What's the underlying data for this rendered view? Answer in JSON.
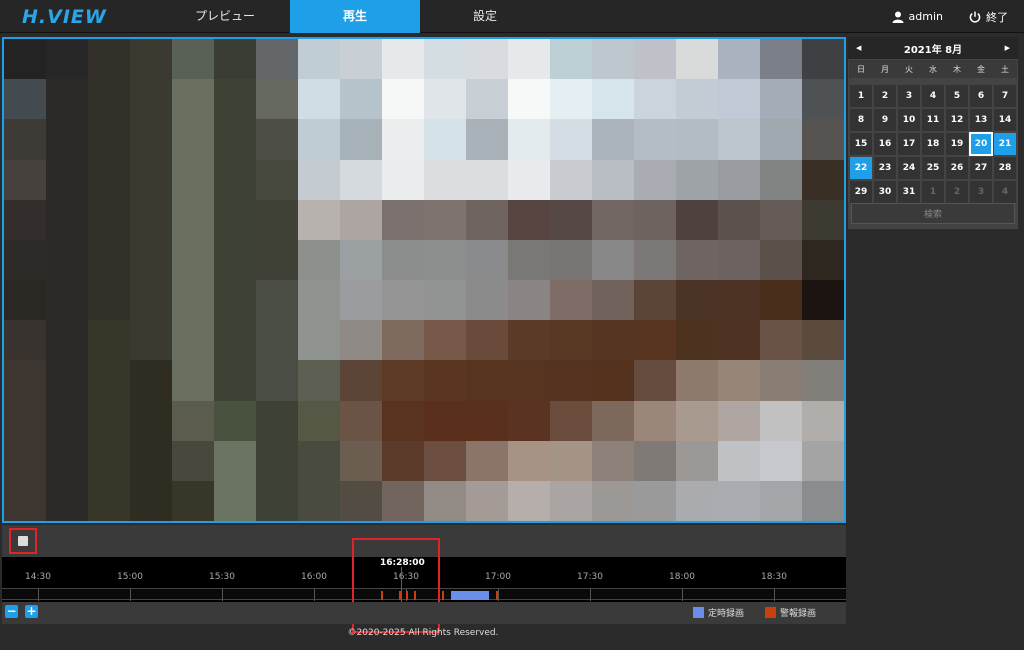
{
  "app": {
    "logo": "H.VIEW"
  },
  "nav": {
    "tabs": [
      {
        "label": "プレビュー"
      },
      {
        "label": "再生"
      },
      {
        "label": "設定"
      }
    ],
    "active": 1
  },
  "user": {
    "name": "admin",
    "exit_label": "終了"
  },
  "playback": {
    "current_time": "16:28:00",
    "time_labels": [
      "14:30",
      "15:00",
      "15:30",
      "16:00",
      "16:30",
      "17:00",
      "17:30",
      "18:00",
      "18:30"
    ],
    "legend": {
      "scheduled": "定時録画",
      "alarm": "警報録画"
    },
    "colors": {
      "scheduled": "#6b8ee8",
      "alarm": "#c84010",
      "accent": "#1e9fe8"
    }
  },
  "calendar": {
    "title": "2021年 8月",
    "weekdays": [
      "日",
      "月",
      "火",
      "水",
      "木",
      "金",
      "土"
    ],
    "days": [
      {
        "d": "1"
      },
      {
        "d": "2"
      },
      {
        "d": "3"
      },
      {
        "d": "4"
      },
      {
        "d": "5"
      },
      {
        "d": "6"
      },
      {
        "d": "7"
      },
      {
        "d": "8"
      },
      {
        "d": "9"
      },
      {
        "d": "10"
      },
      {
        "d": "11"
      },
      {
        "d": "12"
      },
      {
        "d": "13"
      },
      {
        "d": "14"
      },
      {
        "d": "15"
      },
      {
        "d": "16"
      },
      {
        "d": "17"
      },
      {
        "d": "18"
      },
      {
        "d": "19"
      },
      {
        "d": "20",
        "s": "sel"
      },
      {
        "d": "21",
        "s": "rec"
      },
      {
        "d": "22",
        "s": "rec"
      },
      {
        "d": "23"
      },
      {
        "d": "24"
      },
      {
        "d": "25"
      },
      {
        "d": "26"
      },
      {
        "d": "27"
      },
      {
        "d": "28"
      },
      {
        "d": "29"
      },
      {
        "d": "30"
      },
      {
        "d": "31"
      },
      {
        "d": "1",
        "s": "other"
      },
      {
        "d": "2",
        "s": "other"
      },
      {
        "d": "3",
        "s": "other"
      },
      {
        "d": "4",
        "s": "other"
      }
    ],
    "search_label": "検索"
  },
  "footer": {
    "copyright": "©2020-2025 All Rights Reserved."
  },
  "video_palette": [
    [
      "#232323",
      "#272727",
      "#33302a",
      "#3a3a30",
      "#596055",
      "#3a3d33",
      "#63676a",
      "#c1cdd5",
      "#c8d0d6",
      "#e7e8ea",
      "#d4dde2",
      "#d8dce0",
      "#e6e9ea",
      "#bcd0d6",
      "#bfc7ce",
      "#bec2c8",
      "#d9dbda",
      "#a9b2bf",
      "#7b8088",
      "#3f4044"
    ],
    [
      "#434a50",
      "#2b2a28",
      "#33302a",
      "#3a3a30",
      "#6a7060",
      "#3e4234",
      "#66695f",
      "#d0dde4",
      "#b7c3ca",
      "#f6f7f7",
      "#dfe5e8",
      "#c8cfd5",
      "#f7f8f8",
      "#e5eef3",
      "#d6e4ec",
      "#c9d4dc",
      "#c3ccd4",
      "#bfcad6",
      "#a3adb8",
      "#4f5254"
    ],
    [
      "#3e3a36",
      "#2b2a28",
      "#33302a",
      "#3a3a30",
      "#6a7060",
      "#3e4234",
      "#4d4f47",
      "#c0ccd3",
      "#a7b1b8",
      "#ebedee",
      "#d5e2e8",
      "#aab2b9",
      "#e4ebef",
      "#d3dde3",
      "#abb4bd",
      "#b5bdc4",
      "#b3bcc4",
      "#bcc5ce",
      "#a0a8b0",
      "#575350"
    ],
    [
      "#46413d",
      "#2b2a28",
      "#33302a",
      "#3a3a30",
      "#6a7060",
      "#3e4234",
      "#47493f",
      "#c4ccd1",
      "#d4dade",
      "#eaebec",
      "#dadcde",
      "#dadee1",
      "#e7ebee",
      "#c8ccd0",
      "#b8bec4",
      "#a9adb3",
      "#9ea3a8",
      "#989ca0",
      "#7f8483",
      "#3a2f24"
    ],
    [
      "#332e2b",
      "#2b2a28",
      "#33302a",
      "#3a3a30",
      "#6a7060",
      "#3e4234",
      "#3f4137",
      "#b7b2ad",
      "#aca5a1",
      "#7a716e",
      "#7f7370",
      "#6f6460",
      "#564540",
      "#564844",
      "#726662",
      "#6f6360",
      "#4e413e",
      "#5c514d",
      "#655b57",
      "#3d3a32"
    ],
    [
      "#2e2a27",
      "#2b2a28",
      "#33302a",
      "#3a3a30",
      "#6a7060",
      "#3e4234",
      "#3f4137",
      "#8e908c",
      "#9ba0a3",
      "#8c8e8e",
      "#8d8f8f",
      "#8a8b8c",
      "#7a7875",
      "#787675",
      "#878787",
      "#7b7877",
      "#6e6562",
      "#6c6260",
      "#5b514a",
      "#2d271f"
    ],
    [
      "#2b2723",
      "#2b2a28",
      "#33302a",
      "#3a3a30",
      "#6a7060",
      "#3e4234",
      "#4a4d43",
      "#8f938f",
      "#9a9c9f",
      "#959596",
      "#929393",
      "#8c8b8b",
      "#8a8584",
      "#7e6d67",
      "#72625c",
      "#5c4436",
      "#4b3325",
      "#4d3323",
      "#4a2e1c",
      "#1b1410"
    ],
    [
      "#38332f",
      "#2b2a28",
      "#383629",
      "#3a3a30",
      "#6a7060",
      "#3e4234",
      "#4a4d43",
      "#8f938f",
      "#908a86",
      "#7f6a5f",
      "#775849",
      "#6a4b3b",
      "#5c3a28",
      "#5a3924",
      "#563522",
      "#573521",
      "#4e3220",
      "#4f3322",
      "#6a5346",
      "#5b4b3e"
    ],
    [
      "#3d3530",
      "#2b2a28",
      "#383629",
      "#2f2d22",
      "#6a7060",
      "#3e4234",
      "#4a4d43",
      "#5e5f53",
      "#5c4537",
      "#5d3b24",
      "#5a3620",
      "#57341e",
      "#56341f",
      "#553320",
      "#54321e",
      "#664c3e",
      "#8d7a6c",
      "#978578",
      "#8a7d74",
      "#827e79"
    ],
    [
      "#3d3530",
      "#2b2a28",
      "#383629",
      "#2f2d22",
      "#5b5c4d",
      "#49523f",
      "#3e4234",
      "#565846",
      "#6b5445",
      "#5a3320",
      "#5a2f1c",
      "#5a301d",
      "#5b3322",
      "#6a4d3d",
      "#7d695c",
      "#9a8779",
      "#a99a8f",
      "#afa6a1",
      "#c2c1c1",
      "#b1adab"
    ],
    [
      "#3d3530",
      "#2b2a28",
      "#383629",
      "#2f2d22",
      "#4a483c",
      "#6b7363",
      "#3e4234",
      "#494b3f",
      "#6c5d51",
      "#5d3b2b",
      "#6c4e40",
      "#8a7568",
      "#a69385",
      "#a49387",
      "#8e8179",
      "#807a76",
      "#9c9896",
      "#bfc1c4",
      "#c6c8cd",
      "#a5a4a5"
    ],
    [
      "#3d3530",
      "#2b2a28",
      "#383629",
      "#2f2d22",
      "#383629",
      "#6b7363",
      "#3e4234",
      "#494b3f",
      "#524c43",
      "#72655e",
      "#928a85",
      "#a49b97",
      "#b5aeab",
      "#aaa5a2",
      "#9b9896",
      "#9b9a9a",
      "#a9abae",
      "#a9adb2",
      "#a3a5a8",
      "#8a8c8e"
    ]
  ]
}
